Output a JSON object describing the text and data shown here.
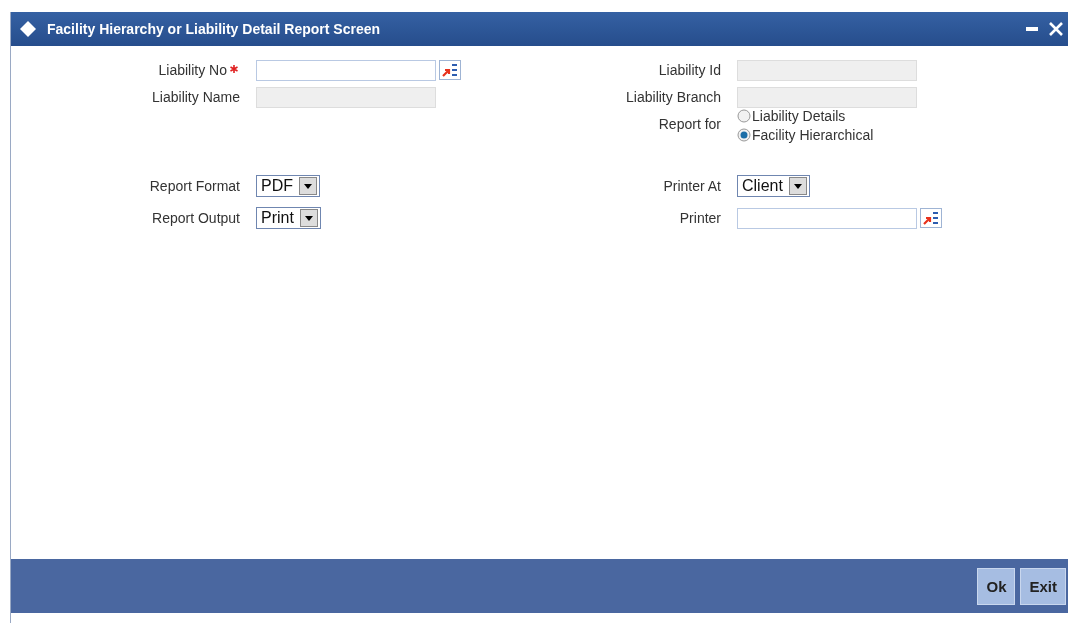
{
  "window": {
    "title": "Facility Hierarchy or Liability Detail Report Screen"
  },
  "rows": [
    {
      "left": {
        "label": "Liability No",
        "required": true,
        "kind": "lookup"
      },
      "right": {
        "label": "Liability Id",
        "required": false,
        "kind": "readonly"
      }
    },
    {
      "left": {
        "label": "Liability Name",
        "required": false,
        "kind": "readonly"
      },
      "right": {
        "label": "Liability Branch",
        "required": false,
        "kind": "readonly"
      }
    },
    {
      "right": {
        "label": "Report for",
        "required": false,
        "kind": "radio",
        "options": [
          {
            "label": "Liability Details",
            "selected": false
          },
          {
            "label": "Facility Hierarchical",
            "selected": true
          }
        ]
      }
    },
    {
      "left": {
        "label": "Report Format",
        "required": false,
        "kind": "select",
        "value": "PDF"
      },
      "right": {
        "label": "Printer At",
        "required": false,
        "kind": "select",
        "value": "Client"
      }
    },
    {
      "left": {
        "label": "Report Output",
        "required": false,
        "kind": "select",
        "value": "Print"
      },
      "right": {
        "label": "Printer",
        "required": false,
        "kind": "lookup"
      }
    }
  ],
  "buttons": [
    "Ok",
    "Exit"
  ]
}
